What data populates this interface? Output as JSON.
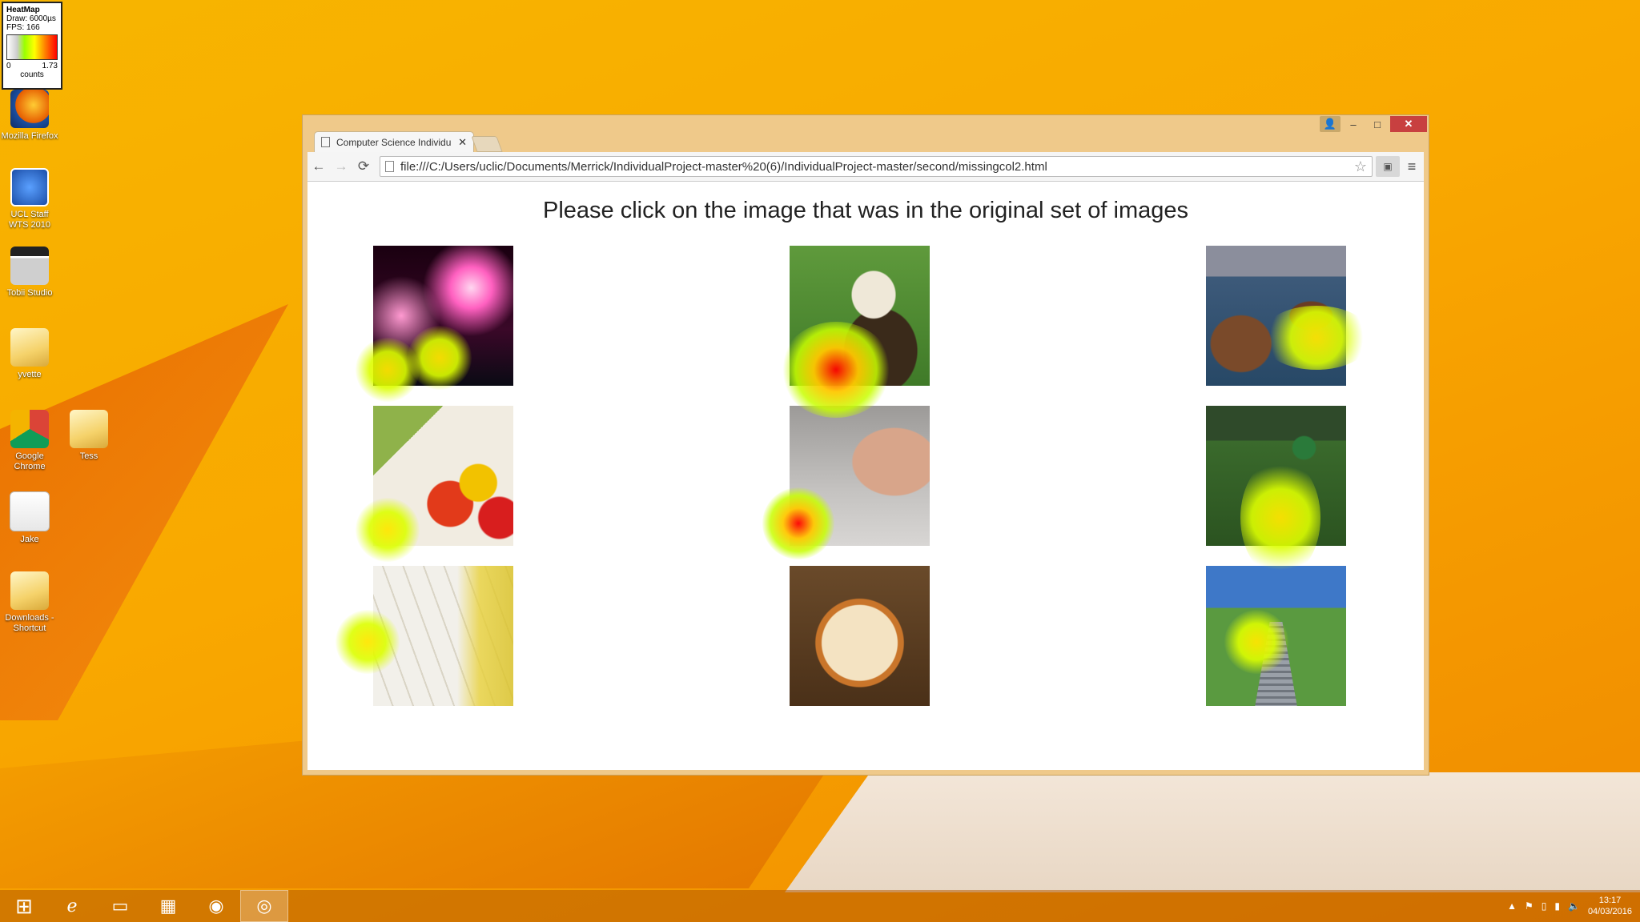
{
  "heatmap_legend": {
    "title": "HeatMap",
    "draw": "Draw: 6000µs",
    "fps": "FPS: 166",
    "min": "0",
    "max": "1.73",
    "unit": "counts"
  },
  "desktop_icons": [
    {
      "label": "Mozilla Firefox",
      "icon": "firefox-icon"
    },
    {
      "label": "UCL Staff WTS 2010",
      "icon": "remote-desktop-icon"
    },
    {
      "label": "Tobii Studio",
      "icon": "tobii-icon"
    },
    {
      "label": "yvette",
      "icon": "folder-icon"
    },
    {
      "label": "Google Chrome",
      "icon": "chrome-icon"
    },
    {
      "label": "Tess",
      "icon": "folder-icon"
    },
    {
      "label": "Jake",
      "icon": "document-icon"
    },
    {
      "label": "Downloads - Shortcut",
      "icon": "downloads-folder-icon"
    }
  ],
  "browser": {
    "tab_title": "Computer Science Individu",
    "url": "file:///C:/Users/uclic/Documents/Merrick/IndividualProject-master%20(6)/IndividualProject-master/second/missingcol2.html",
    "controls": {
      "user": "👤",
      "minimize": "–",
      "maximize": "□",
      "close": "✕"
    },
    "nav": {
      "back": "←",
      "forward": "→",
      "reload": "⟳",
      "star": "☆",
      "menu": "≡"
    }
  },
  "page": {
    "prompt": "Please click on the image that was in the original set of images",
    "images": [
      {
        "subject": "fireworks"
      },
      {
        "subject": "eagle"
      },
      {
        "subject": "sea stacks"
      },
      {
        "subject": "vegetables"
      },
      {
        "subject": "hand with cable"
      },
      {
        "subject": "boy playing soccer"
      },
      {
        "subject": "measuring tape"
      },
      {
        "subject": "pizza"
      },
      {
        "subject": "park stairs"
      }
    ]
  },
  "taskbar": {
    "items": [
      "start-icon",
      "internet-explorer-icon",
      "file-explorer-icon",
      "store-icon",
      "firefox-icon",
      "chrome-icon"
    ],
    "time": "13:17",
    "date": "04/03/2016"
  }
}
